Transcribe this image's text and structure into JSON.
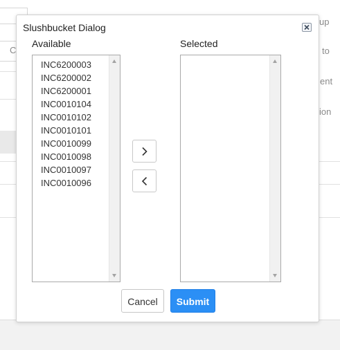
{
  "background": {
    "fragments": [
      "up",
      "to",
      "ent",
      "ion"
    ],
    "radio_glyph": "C"
  },
  "dialog": {
    "title": "Slushbucket Dialog",
    "close_icon": "close-icon",
    "available": {
      "label": "Available",
      "items": [
        "INC6200003",
        "INC6200002",
        "INC6200001",
        "INC0010104",
        "INC0010102",
        "INC0010101",
        "INC0010099",
        "INC0010098",
        "INC0010097",
        "INC0010096"
      ]
    },
    "selected": {
      "label": "Selected",
      "items": []
    },
    "move_right_icon": "chevron-right-icon",
    "move_left_icon": "chevron-left-icon",
    "buttons": {
      "cancel": "Cancel",
      "submit": "Submit"
    }
  },
  "colors": {
    "primary": "#2b8ff5",
    "border": "#a9a9a9",
    "text": "#222222"
  }
}
